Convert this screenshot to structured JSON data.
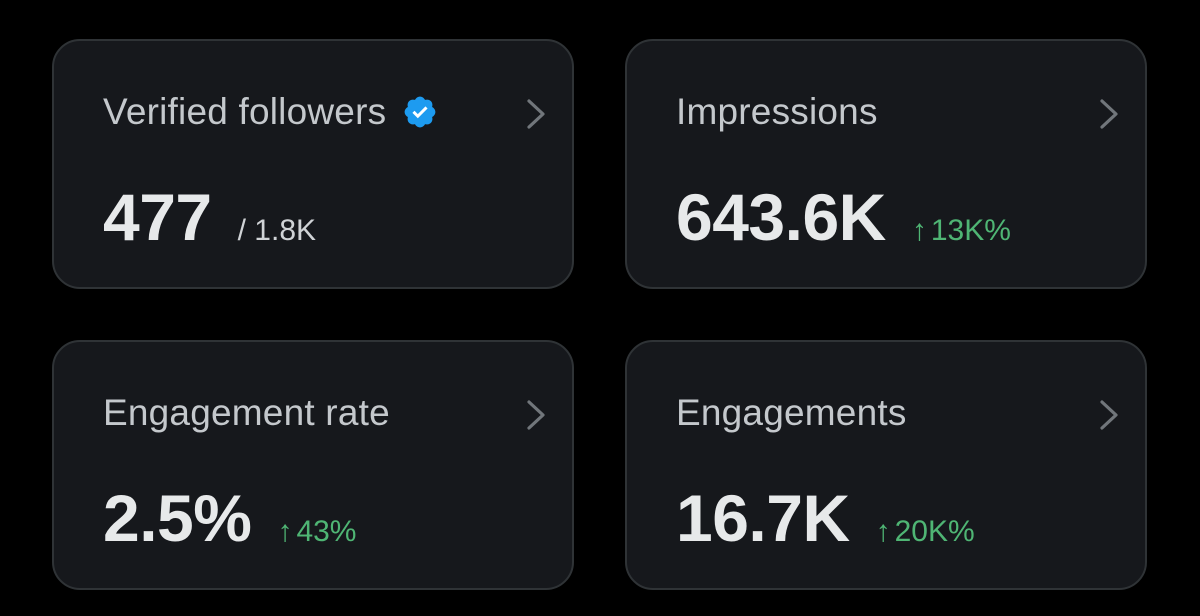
{
  "colors": {
    "background": "#000000",
    "card_background": "#16181c",
    "card_border": "#2f3336",
    "title_text": "#c4c8cc",
    "value_text": "#e7e9ea",
    "positive_delta": "#4fb574",
    "verified_badge": "#1d9bf0",
    "chevron": "#71767b"
  },
  "cards": [
    {
      "title": "Verified followers",
      "value": "477",
      "sub": "/ 1.8K",
      "badge_icon": "verified-badge-icon",
      "nav_icon": "chevron-right-icon"
    },
    {
      "title": "Impressions",
      "value": "643.6K",
      "delta_arrow": "↑",
      "delta": "13K%",
      "nav_icon": "chevron-right-icon"
    },
    {
      "title": "Engagement rate",
      "value": "2.5%",
      "delta_arrow": "↑",
      "delta": "43%",
      "nav_icon": "chevron-right-icon"
    },
    {
      "title": "Engagements",
      "value": "16.7K",
      "delta_arrow": "↑",
      "delta": "20K%",
      "nav_icon": "chevron-right-icon"
    }
  ]
}
